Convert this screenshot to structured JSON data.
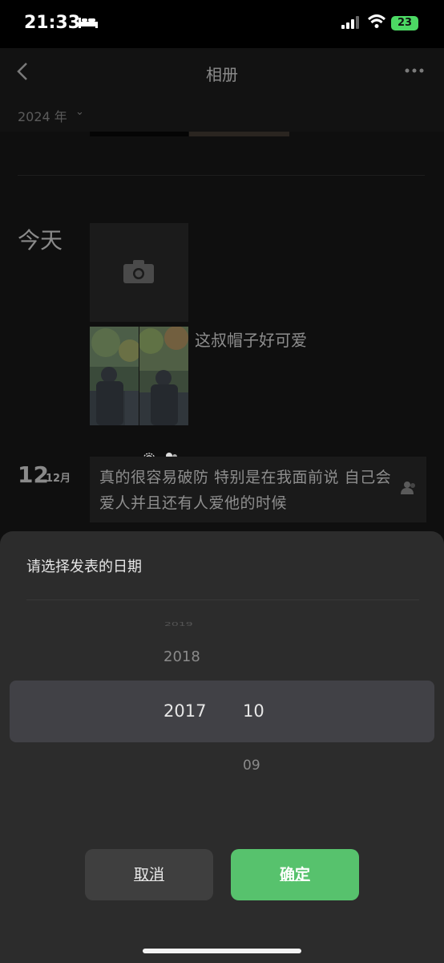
{
  "status_bar": {
    "time": "21:33",
    "battery": "23"
  },
  "nav": {
    "title": "相册"
  },
  "year_filter": {
    "label": "2024 年"
  },
  "feed": {
    "today_label": "今天",
    "post1_caption": "这叔帽子好可爱",
    "post2_day": "12",
    "post2_month": "12月",
    "post2_text": "真的很容易破防 特别是在我面前说 自己会爱人并且还有人爱他的时候"
  },
  "date_picker": {
    "title": "请选择发表的日期",
    "years": [
      "2019",
      "2018",
      "2017"
    ],
    "selected_year": "2017",
    "selected_month": "10",
    "months_below": [
      "09"
    ],
    "cancel_label": "取消",
    "confirm_label": "确定"
  },
  "colors": {
    "confirm": "#57c26d",
    "sheet": "#2c2c2c",
    "battery": "#4cd964"
  }
}
